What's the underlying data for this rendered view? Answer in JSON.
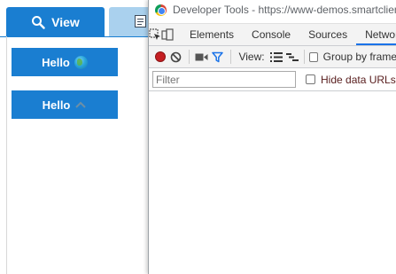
{
  "demo": {
    "tabs": [
      {
        "label": "View",
        "icon": "search-icon",
        "selected": true
      },
      {
        "label": "",
        "icon": "document-icon",
        "selected": false
      }
    ],
    "buttons": [
      {
        "label": "Hello",
        "icon": "globe-icon"
      },
      {
        "label": "Hello",
        "icon": "chevron-up-icon"
      }
    ]
  },
  "devtools": {
    "window_title": "Developer Tools - https://www-demos.smartclient.com",
    "panel_tabs": [
      "Elements",
      "Console",
      "Sources",
      "Network"
    ],
    "active_tab": "Network",
    "toolbar": {
      "view_label": "View:",
      "group_label": "Group by frame"
    },
    "filter": {
      "placeholder": "Filter",
      "value": "",
      "hide_data_urls_label": "Hide data URLs"
    }
  },
  "colors": {
    "accent": "#1a7ed1",
    "light_tab": "#aad1ee",
    "record_red": "#c51e22",
    "devtools_bar": "#f3f3f3"
  }
}
